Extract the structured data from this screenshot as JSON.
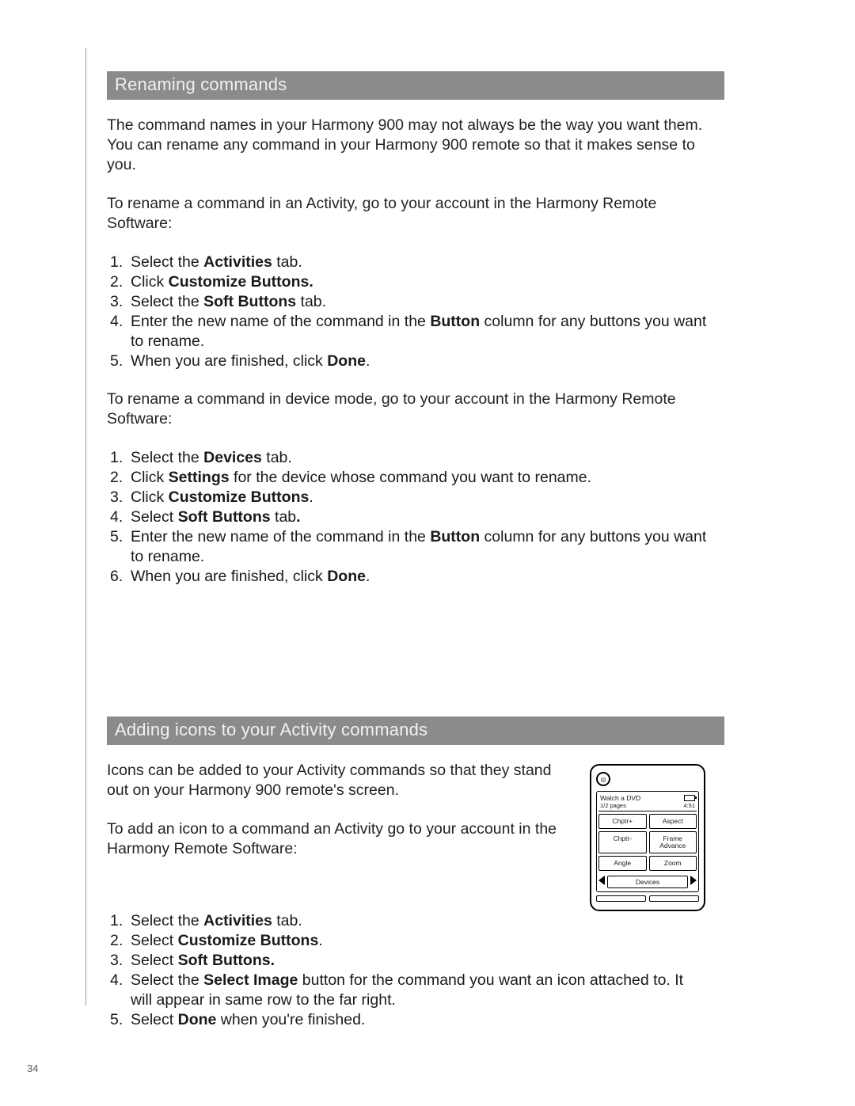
{
  "pageNumber": "34",
  "section1": {
    "header": "Renaming commands",
    "intro1": "The command names in your Harmony 900 may not always be the way you want them. You can rename any command in your Harmony 900 remote so that it makes sense to you.",
    "intro2": "To rename a command in an Activity, go to your account in the Harmony Remote Software:",
    "list1": {
      "i1a": "Select the ",
      "i1b": "Activities",
      "i1c": " tab.",
      "i2a": "Click ",
      "i2b": "Customize Buttons.",
      "i3a": "Select the ",
      "i3b": "Soft Buttons",
      "i3c": " tab.",
      "i4a": "Enter the new name of the command in the ",
      "i4b": "Button",
      "i4c": " column for any buttons you want to rename.",
      "i5a": "When you are finished, click ",
      "i5b": "Done",
      "i5c": "."
    },
    "intro3": "To rename a command in device mode, go to your account in the Harmony Remote Software:",
    "list2": {
      "i1a": "Select the ",
      "i1b": "Devices",
      "i1c": " tab.",
      "i2a": "Click ",
      "i2b": "Settings",
      "i2c": " for the device whose command you want to rename.",
      "i3a": "Click ",
      "i3b": "Customize Buttons",
      "i3c": ".",
      "i4a": "Select ",
      "i4b": "Soft Buttons",
      "i4c": " tab",
      "i4d": ".",
      "i5a": "Enter the new name of the command in the ",
      "i5b": "Button",
      "i5c": " column for any buttons you want to rename.",
      "i6a": "When you are finished, click ",
      "i6b": "Done",
      "i6c": "."
    }
  },
  "section2": {
    "header": "Adding icons to your Activity commands",
    "intro1": "Icons can be added to your Activity commands so that they stand out on your Harmony 900 remote's screen.",
    "intro2": "To add an icon to a command an Activity go to your account in the Harmony Remote Software:",
    "list": {
      "i1a": "Select the ",
      "i1b": "Activities",
      "i1c": " tab.",
      "i2a": "Select ",
      "i2b": "Customize Buttons",
      "i2c": ".",
      "i3a": "Select ",
      "i3b": "Soft Buttons.",
      "i4a": "Select the ",
      "i4b": "Select Image",
      "i4c": " button for the command you want an icon attached to. It will appear in same row to the far right.",
      "i5a": "Select ",
      "i5b": "Done",
      "i5c": " when you're finished."
    }
  },
  "remote": {
    "title": "Watch a DVD",
    "pages": "1/2 pages",
    "time": "4:51",
    "cells": [
      "Chptr+",
      "Aspect",
      "Chptr-",
      "Frame Advance",
      "Angle",
      "Zoom"
    ],
    "devices": "Devices"
  }
}
